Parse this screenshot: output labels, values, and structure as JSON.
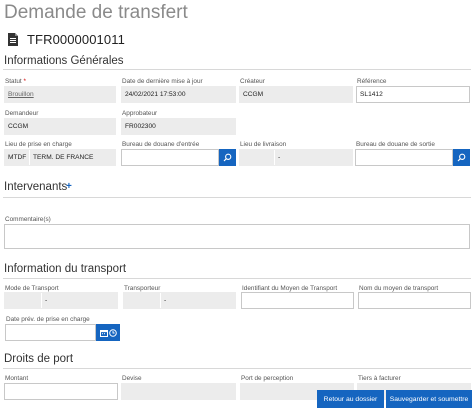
{
  "page": {
    "title": "Demande de transfert",
    "document_number": "TFR0000001011"
  },
  "general": {
    "section_title": "Informations Générales",
    "statut": {
      "label": "Statut",
      "required_mark": "*",
      "value": "Brouillon"
    },
    "date_maj": {
      "label": "Date de dernière mise à jour",
      "value": "24/02/2021 17:53:00"
    },
    "createur": {
      "label": "Créateur",
      "value": "CCGM"
    },
    "reference": {
      "label": "Référence",
      "value": "SL1412"
    },
    "demandeur": {
      "label": "Demandeur",
      "value": "CCGM"
    },
    "approbateur": {
      "label": "Approbateur",
      "value": "FR002300"
    },
    "lieu_prise": {
      "label": "Lieu de prise en charge",
      "code": "MTDF",
      "name": "TERM. DE FRANCE"
    },
    "bureau_entree": {
      "label": "Bureau de douane d'entrée",
      "value": ""
    },
    "lieu_livraison": {
      "label": "Lieu de livraison",
      "code": "",
      "name": "-"
    },
    "bureau_sortie": {
      "label": "Bureau de douane de sortie",
      "value": ""
    }
  },
  "intervenants": {
    "section_title": "Intervenants",
    "add_symbol": "+",
    "comment_label": "Commentaire(s)",
    "comment_value": ""
  },
  "transport": {
    "section_title": "Information du transport",
    "mode": {
      "label": "Mode de Transport",
      "code": "",
      "name": "-"
    },
    "transporteur": {
      "label": "Transporteur",
      "code": "",
      "name": "-"
    },
    "identifiant": {
      "label": "Identifiant du Moyen de Transport",
      "value": ""
    },
    "nom_moyen": {
      "label": "Nom du moyen de transport",
      "value": ""
    },
    "date_prev": {
      "label": "Date prév. de prise en charge",
      "value": ""
    }
  },
  "droits": {
    "section_title": "Droits de port",
    "montant_label": "Montant",
    "devise_label": "Devise",
    "port_label": "Port de perception",
    "tiers_label": "Tiers à facturer"
  },
  "actions": {
    "back_label": "Retour au dossier",
    "save_label": "Sauvegarder et soumettre"
  },
  "colors": {
    "accent": "#1565c0",
    "readonly_bg": "#ececec",
    "title_gray": "#8a8a8a"
  },
  "icons": [
    "document-icon",
    "search-icon",
    "calendar-icon",
    "clock-icon",
    "plus-icon"
  ]
}
